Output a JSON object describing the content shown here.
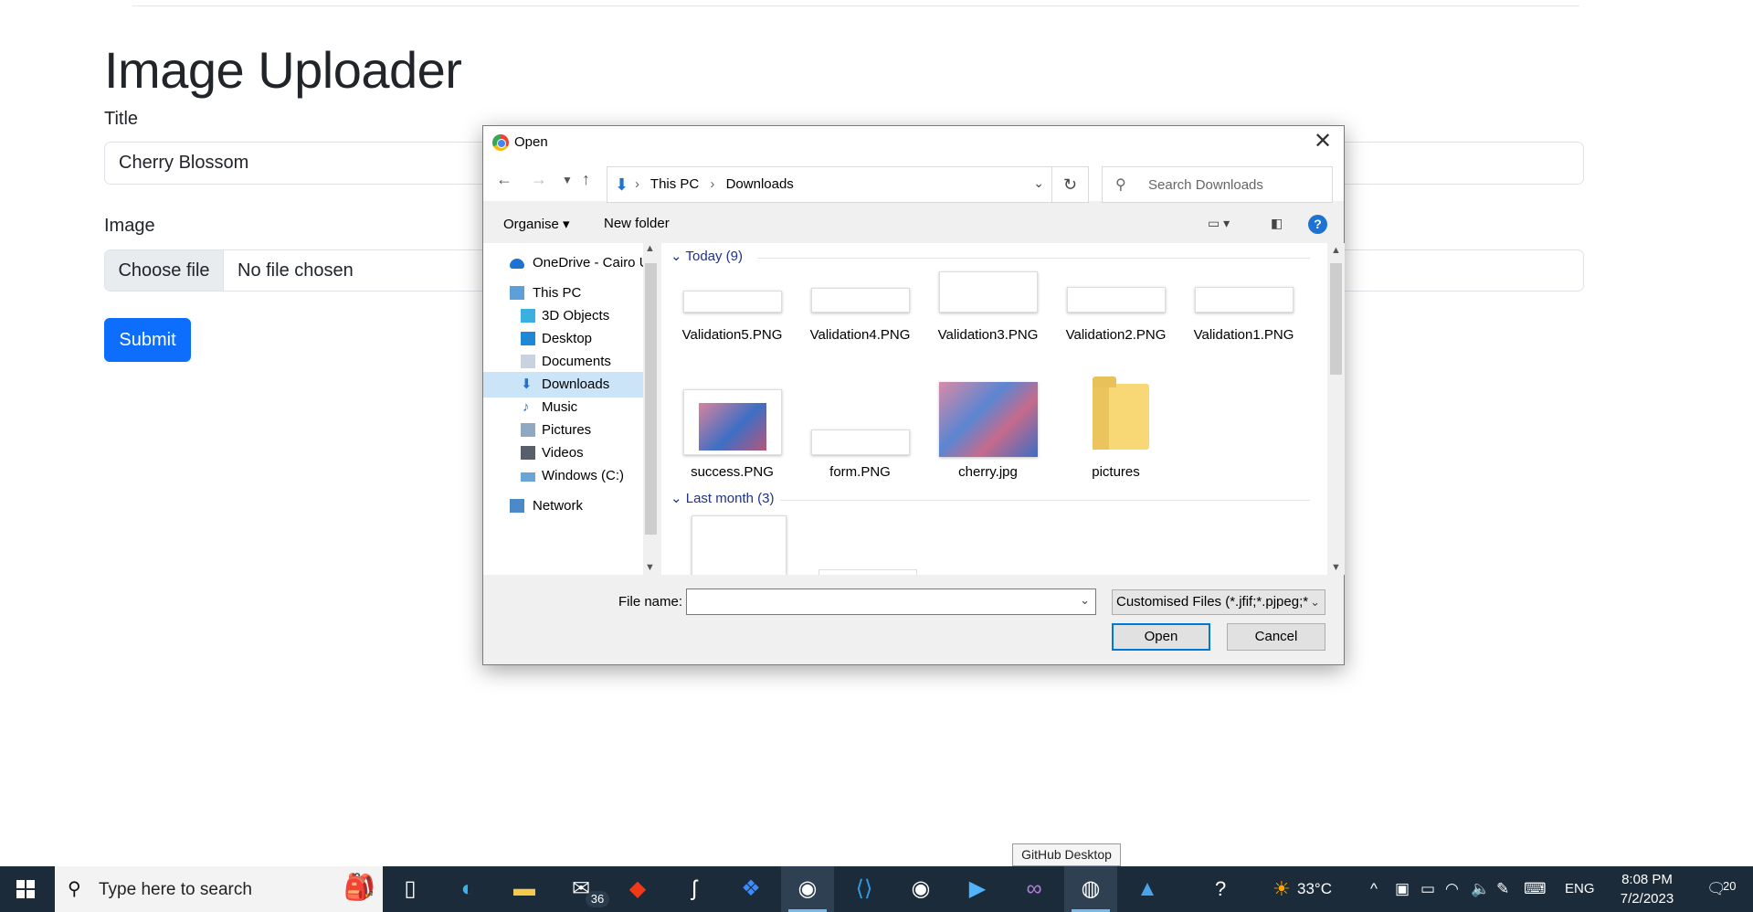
{
  "page": {
    "title": "Image Uploader",
    "title_label": "Title",
    "title_value": "Cherry Blossom",
    "image_label": "Image",
    "choose_file": "Choose file",
    "no_file": "No file chosen",
    "submit": "Submit"
  },
  "dialog": {
    "title": "Open",
    "close": "✕",
    "breadcrumb": [
      "This PC",
      "Downloads"
    ],
    "search_placeholder": "Search Downloads",
    "organise": "Organise ▾",
    "new_folder": "New folder",
    "help": "?",
    "nav_items": [
      {
        "label": "OneDrive - Cairo U",
        "icon": "onedrive-icon"
      },
      {
        "label": "This PC",
        "icon": "computer-icon"
      },
      {
        "label": "3D Objects",
        "icon": "cube-icon"
      },
      {
        "label": "Desktop",
        "icon": "desktop-icon"
      },
      {
        "label": "Documents",
        "icon": "documents-icon"
      },
      {
        "label": "Downloads",
        "icon": "download-icon",
        "selected": true
      },
      {
        "label": "Music",
        "icon": "music-icon"
      },
      {
        "label": "Pictures",
        "icon": "pictures-icon"
      },
      {
        "label": "Videos",
        "icon": "videos-icon"
      },
      {
        "label": "Windows (C:)",
        "icon": "drive-icon"
      },
      {
        "label": "Network",
        "icon": "network-icon"
      }
    ],
    "groups": [
      {
        "label": "Today (9)"
      },
      {
        "label": "Last month (3)"
      }
    ],
    "files": [
      {
        "name": "Validation5.PNG"
      },
      {
        "name": "Validation4.PNG"
      },
      {
        "name": "Validation3.PNG"
      },
      {
        "name": "Validation2.PNG"
      },
      {
        "name": "Validation1.PNG"
      },
      {
        "name": "success.PNG"
      },
      {
        "name": "form.PNG"
      },
      {
        "name": "cherry.jpg"
      },
      {
        "name": "pictures"
      }
    ],
    "file_name_label": "File name:",
    "file_name_value": "",
    "filter": "Customised Files (*.jfif;*.pjpeg;*",
    "open": "Open",
    "cancel": "Cancel"
  },
  "tooltip": "GitHub Desktop",
  "taskbar": {
    "search_placeholder": "Type here to search",
    "mail_badge": "36",
    "weather": "33°C",
    "lang": "ENG",
    "time": "8:08 PM",
    "date": "7/2/2023",
    "notifications": "20"
  }
}
